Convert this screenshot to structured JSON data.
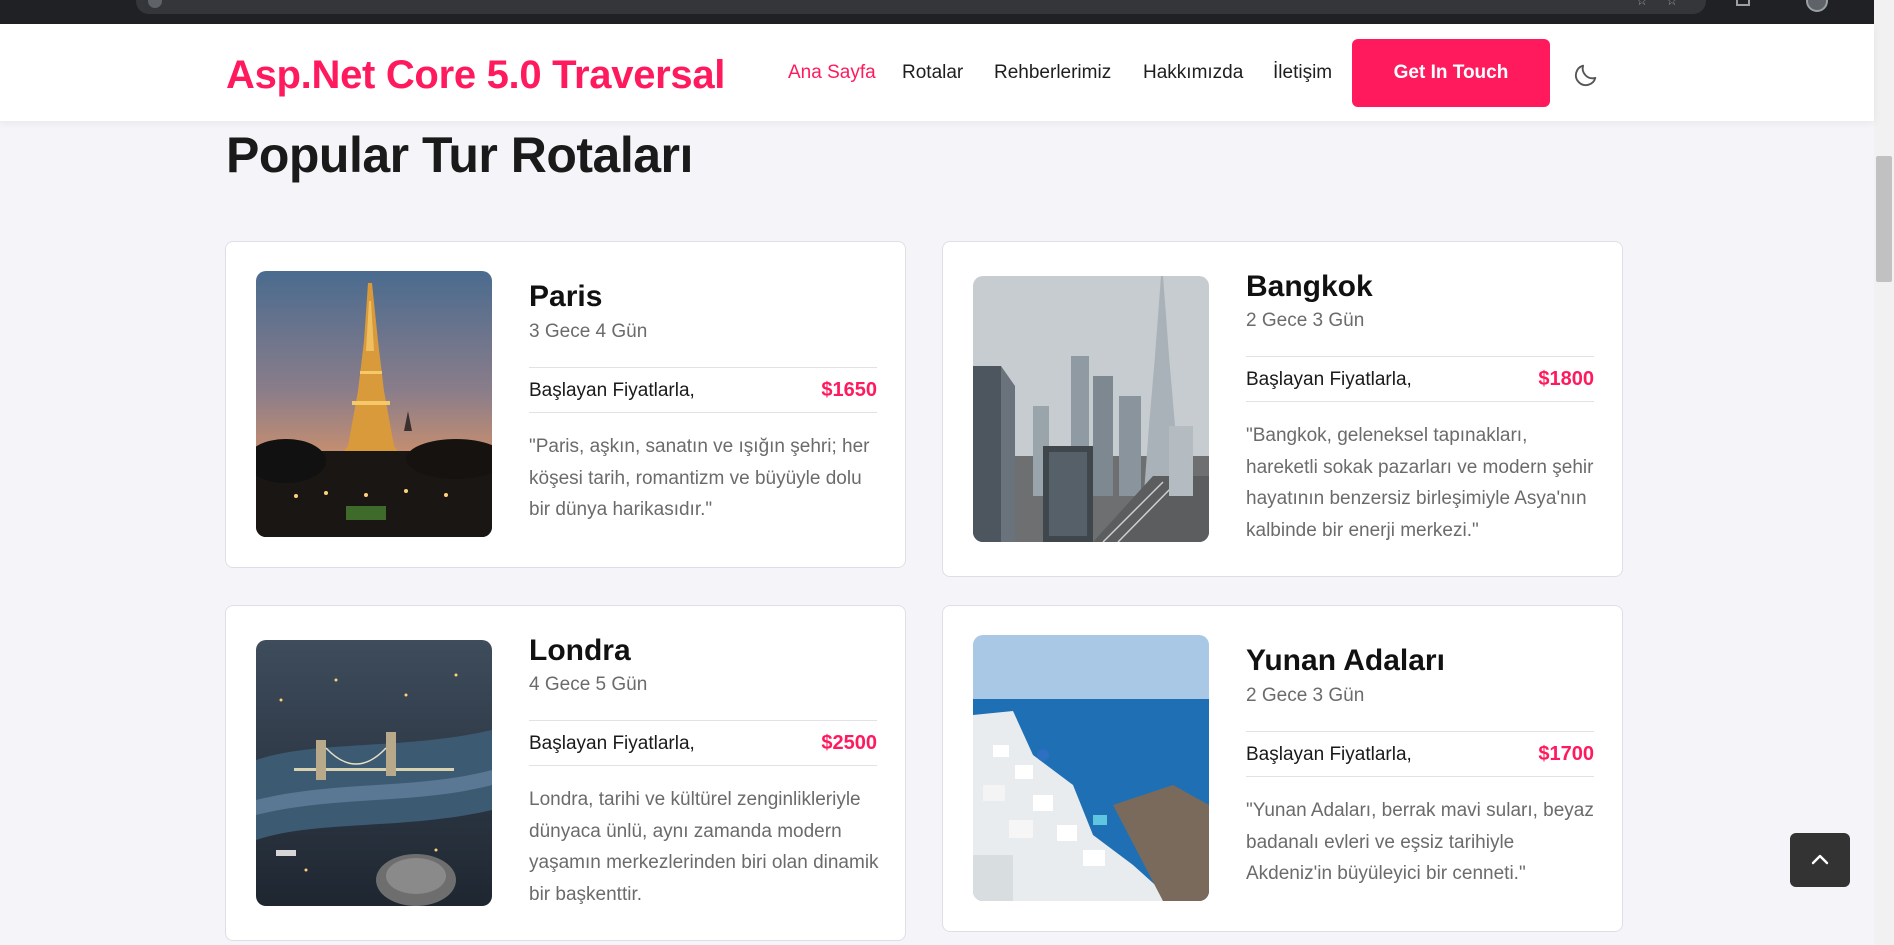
{
  "navbar": {
    "brand": "Asp.Net Core 5.0 Traversal",
    "links": [
      "Ana Sayfa",
      "Rotalar",
      "Rehberlerimiz",
      "Hakkımızda",
      "İletişim"
    ],
    "active_link": "Ana Sayfa",
    "cta_label": "Get In Touch",
    "theme_icon": "moon-icon"
  },
  "section": {
    "title": "Popular Tur Rotaları"
  },
  "tours": [
    {
      "name": "Paris",
      "duration": "3 Gece 4 Gün",
      "price_label": "Başlayan Fiyatlarla,",
      "price": "$1650",
      "description": "\"Paris, aşkın, sanatın ve ışığın şehri; her köşesi tarih, romantizm ve büyüyle dolu bir dünya harikasıdır.\""
    },
    {
      "name": "Bangkok",
      "duration": "2 Gece 3 Gün",
      "price_label": "Başlayan Fiyatlarla,",
      "price": "$1800",
      "description": "\"Bangkok, geleneksel tapınakları, hareketli sokak pazarları ve modern şehir hayatının benzersiz birleşimiyle Asya'nın kalbinde bir enerji merkezi.\""
    },
    {
      "name": "Londra",
      "duration": "4 Gece 5 Gün",
      "price_label": "Başlayan Fiyatlarla,",
      "price": "$2500",
      "description": "Londra, tarihi ve kültürel zenginlikleriyle dünyaca ünlü, aynı zamanda modern yaşamın merkezlerinden biri olan dinamik bir başkenttir."
    },
    {
      "name": "Yunan Adaları",
      "duration": "2 Gece 3 Gün",
      "price_label": "Başlayan Fiyatlarla,",
      "price": "$1700",
      "description": "\"Yunan Adaları, berrak mavi suları, beyaz badanalı evleri ve eşsiz tarihiyle Akdeniz'in büyüleyici bir cenneti.\""
    }
  ],
  "colors": {
    "accent": "#ff1a5e",
    "page_bg": "#f5f5f9",
    "card_bg": "#ffffff",
    "text_muted": "#6b6b6b",
    "back_to_top_bg": "#333333"
  },
  "icons": {
    "back_to_top": "chevron-up-icon"
  }
}
